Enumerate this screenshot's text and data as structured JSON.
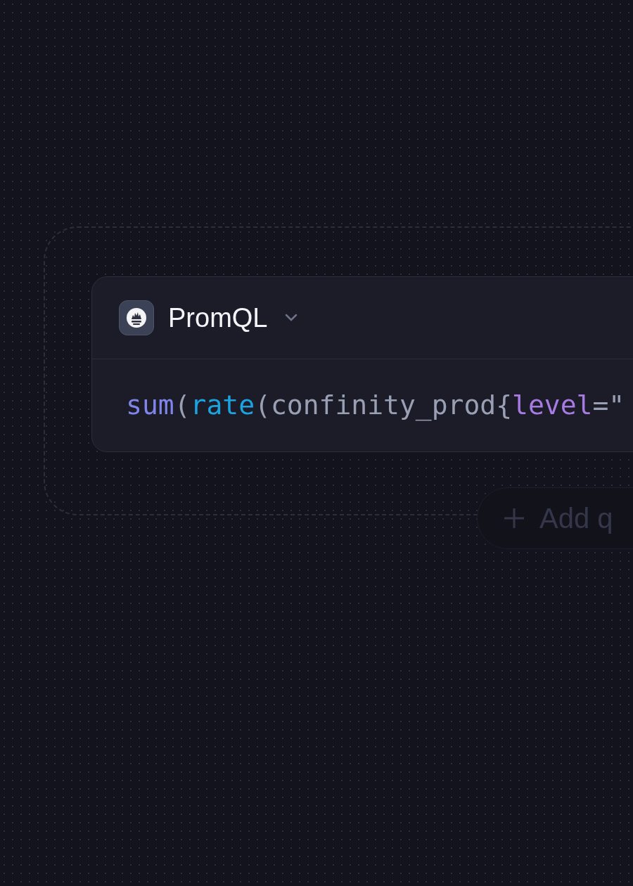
{
  "query_card": {
    "language": "PromQL",
    "code": [
      {
        "kind": "function",
        "text": "sum"
      },
      {
        "kind": "punctuation",
        "text": "("
      },
      {
        "kind": "builtin",
        "text": "rate"
      },
      {
        "kind": "punctuation",
        "text": "(confinity_prod{"
      },
      {
        "kind": "label",
        "text": "level"
      },
      {
        "kind": "punctuation",
        "text": "=\""
      }
    ]
  },
  "add_button": {
    "label": "Add q"
  }
}
